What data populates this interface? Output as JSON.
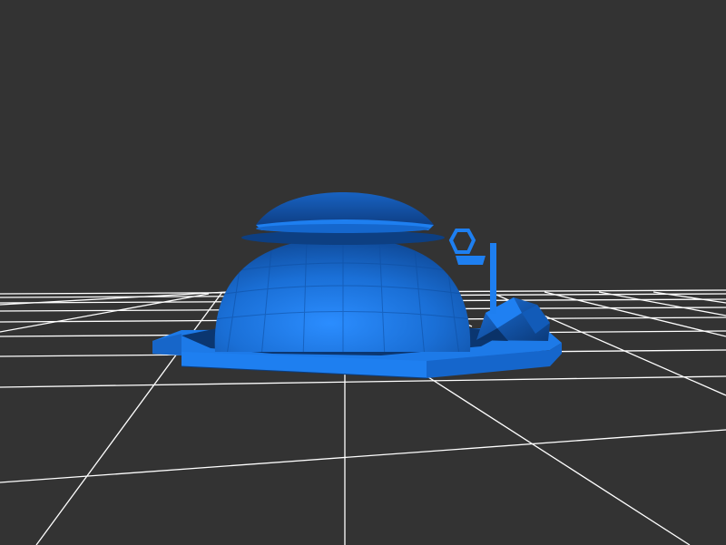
{
  "viewport": {
    "background_color": "#333333",
    "grid_color": "#ffffff",
    "model_color": "#1e7ff0"
  },
  "model": {
    "parts": [
      "dome",
      "dome-cap",
      "platform",
      "rock",
      "antenna-pole",
      "antenna-ring",
      "antenna-arm"
    ]
  }
}
